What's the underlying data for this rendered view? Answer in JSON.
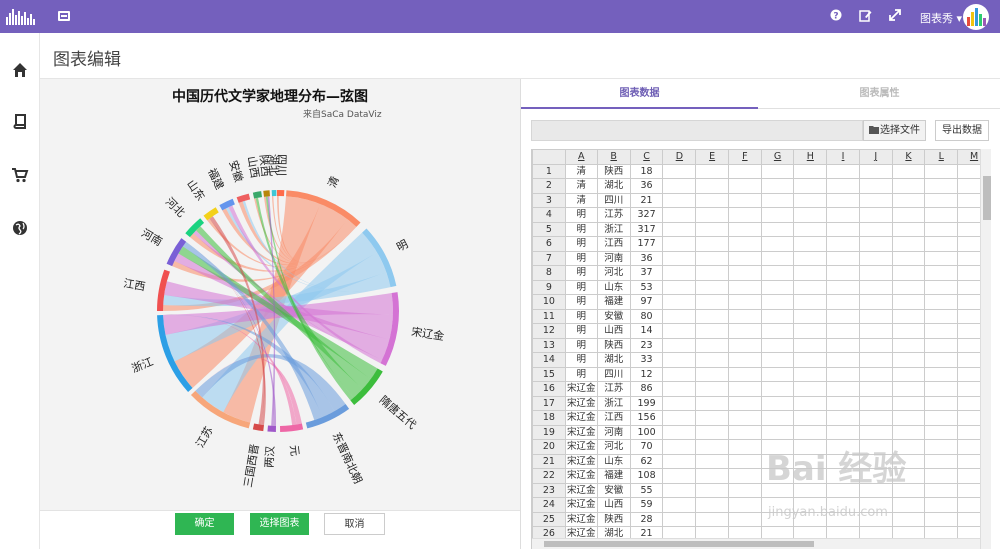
{
  "topbar": {
    "user_name": "图表秀 ▾",
    "icons": [
      "bar-logo-icon",
      "menu-icon",
      "help-icon",
      "edit-icon",
      "expand-icon"
    ]
  },
  "sidebar": {
    "items": [
      "home-icon",
      "book-icon",
      "cart-icon",
      "globe-icon"
    ]
  },
  "page": {
    "title": "图表编辑"
  },
  "chart": {
    "title": "中国历代文学家地理分布—弦图",
    "subtitle": "来自SaCa DataViz"
  },
  "chart_data": {
    "type": "chord",
    "title": "中国历代文学家地理分布—弦图",
    "subtitle": "来自SaCa DataViz",
    "nodes": [
      {
        "name": "清",
        "color": "#fa8b66"
      },
      {
        "name": "明",
        "color": "#8ec9ef"
      },
      {
        "name": "宋辽金",
        "color": "#d473d4"
      },
      {
        "name": "隋唐五代",
        "color": "#3cbd3c"
      },
      {
        "name": "东晋南北朝",
        "color": "#6a9cdc"
      },
      {
        "name": "元",
        "color": "#ee67a6"
      },
      {
        "name": "两汉",
        "color": "#9f58c9"
      },
      {
        "name": "三国西晋",
        "color": "#d64a4a"
      },
      {
        "name": "江苏",
        "color": "#f7a67a"
      },
      {
        "name": "浙江",
        "color": "#2c9fe6"
      },
      {
        "name": "江西",
        "color": "#f05050"
      },
      {
        "name": "河南",
        "color": "#7a5fd6"
      },
      {
        "name": "河北",
        "color": "#1ad380"
      },
      {
        "name": "山东",
        "color": "#f3d11a"
      },
      {
        "name": "福建",
        "color": "#6495ed"
      },
      {
        "name": "安徽",
        "color": "#ee5f5f"
      },
      {
        "name": "山西",
        "color": "#39a86a"
      },
      {
        "name": "陕西",
        "color": "#b8860b"
      },
      {
        "name": "湖北",
        "color": "#3fc8d6"
      },
      {
        "name": "四川",
        "color": "#ff6b4a"
      }
    ]
  },
  "buttons": {
    "confirm": "确定",
    "choose_chart": "选择图表",
    "cancel": "取消"
  },
  "tabs": {
    "data": "图表数据",
    "props": "图表属性"
  },
  "file": {
    "choose": "选择文件",
    "export": "导出数据"
  },
  "sheet": {
    "columns": [
      "A",
      "B",
      "C",
      "D",
      "E",
      "F",
      "G",
      "H",
      "I",
      "J",
      "K",
      "L",
      "M"
    ],
    "rows": [
      [
        "1",
        "清",
        "陕西",
        "18"
      ],
      [
        "2",
        "清",
        "湖北",
        "36"
      ],
      [
        "3",
        "清",
        "四川",
        "21"
      ],
      [
        "4",
        "明",
        "江苏",
        "327"
      ],
      [
        "5",
        "明",
        "浙江",
        "317"
      ],
      [
        "6",
        "明",
        "江西",
        "177"
      ],
      [
        "7",
        "明",
        "河南",
        "36"
      ],
      [
        "8",
        "明",
        "河北",
        "37"
      ],
      [
        "9",
        "明",
        "山东",
        "53"
      ],
      [
        "10",
        "明",
        "福建",
        "97"
      ],
      [
        "11",
        "明",
        "安徽",
        "80"
      ],
      [
        "12",
        "明",
        "山西",
        "14"
      ],
      [
        "13",
        "明",
        "陕西",
        "23"
      ],
      [
        "14",
        "明",
        "湖北",
        "33"
      ],
      [
        "15",
        "明",
        "四川",
        "12"
      ],
      [
        "16",
        "宋辽金",
        "江苏",
        "86"
      ],
      [
        "17",
        "宋辽金",
        "浙江",
        "199"
      ],
      [
        "18",
        "宋辽金",
        "江西",
        "156"
      ],
      [
        "19",
        "宋辽金",
        "河南",
        "100"
      ],
      [
        "20",
        "宋辽金",
        "河北",
        "70"
      ],
      [
        "21",
        "宋辽金",
        "山东",
        "62"
      ],
      [
        "22",
        "宋辽金",
        "福建",
        "108"
      ],
      [
        "23",
        "宋辽金",
        "安徽",
        "55"
      ],
      [
        "24",
        "宋辽金",
        "山西",
        "59"
      ],
      [
        "25",
        "宋辽金",
        "陕西",
        "28"
      ],
      [
        "26",
        "宋辽金",
        "湖北",
        "21"
      ]
    ]
  },
  "watermark": {
    "text": "Bai 经验",
    "sub": "jingyan.baidu.com"
  }
}
